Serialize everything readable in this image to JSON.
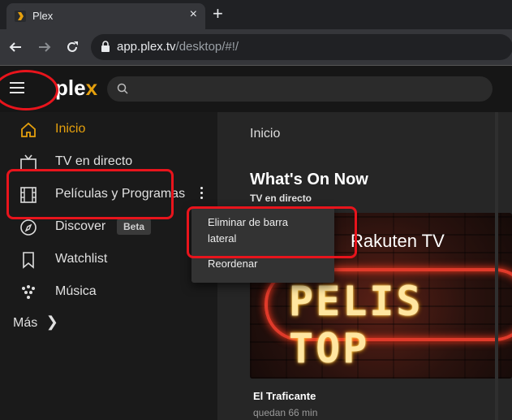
{
  "browser": {
    "tab_title": "Plex",
    "tab_close": "×",
    "new_tab": "+",
    "url_host": "app.plex.tv",
    "url_path": "/desktop/#!/"
  },
  "header": {
    "logo_main": "ple",
    "logo_accent": "x"
  },
  "sidebar": {
    "items": [
      {
        "label": "Inicio",
        "icon": "home-icon",
        "active": true
      },
      {
        "label": "TV en directo",
        "icon": "tv-icon"
      },
      {
        "label": "Películas y Programas",
        "icon": "film-icon"
      },
      {
        "label": "Discover",
        "icon": "compass-icon",
        "badge": "Beta"
      },
      {
        "label": "Watchlist",
        "icon": "bookmark-icon"
      },
      {
        "label": "Música",
        "icon": "music-icon"
      }
    ],
    "more_label": "Más",
    "more_chevron": "❯"
  },
  "context_menu": {
    "remove_line1": "Eliminar de barra",
    "remove_line2": "lateral",
    "reorder": "Reordenar"
  },
  "main": {
    "page_title": "Inicio",
    "section_title": "What's On Now",
    "section_subtitle": "TV en directo",
    "poster_brand": "Rakuten TV",
    "poster_text": "PELIS TOP",
    "item_title": "El Traficante",
    "item_subtitle": "quedan 66 min"
  },
  "colors": {
    "accent": "#e5a00d",
    "annotation": "#e8141c"
  }
}
